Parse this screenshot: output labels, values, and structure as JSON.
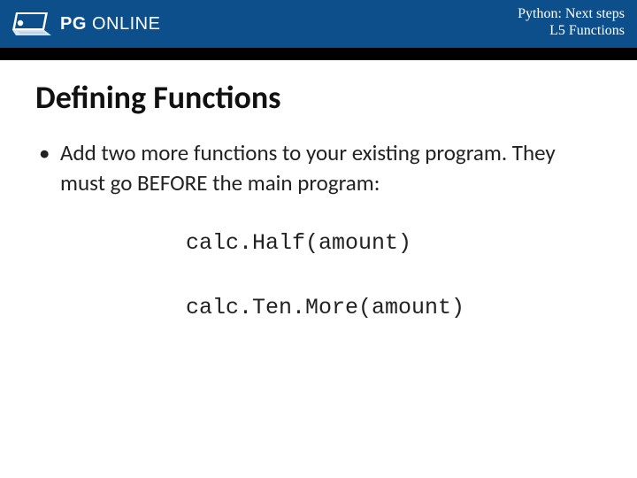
{
  "header": {
    "brand_pg": "PG",
    "brand_online": " ONLINE",
    "course": "Python: Next steps",
    "lesson": "L5 Functions"
  },
  "content": {
    "title": "Defining Functions",
    "bullet": "Add two more functions to your existing program. They must go BEFORE the main program:",
    "code1": "calc.Half(amount)",
    "code2": "calc.Ten.More(amount)"
  }
}
